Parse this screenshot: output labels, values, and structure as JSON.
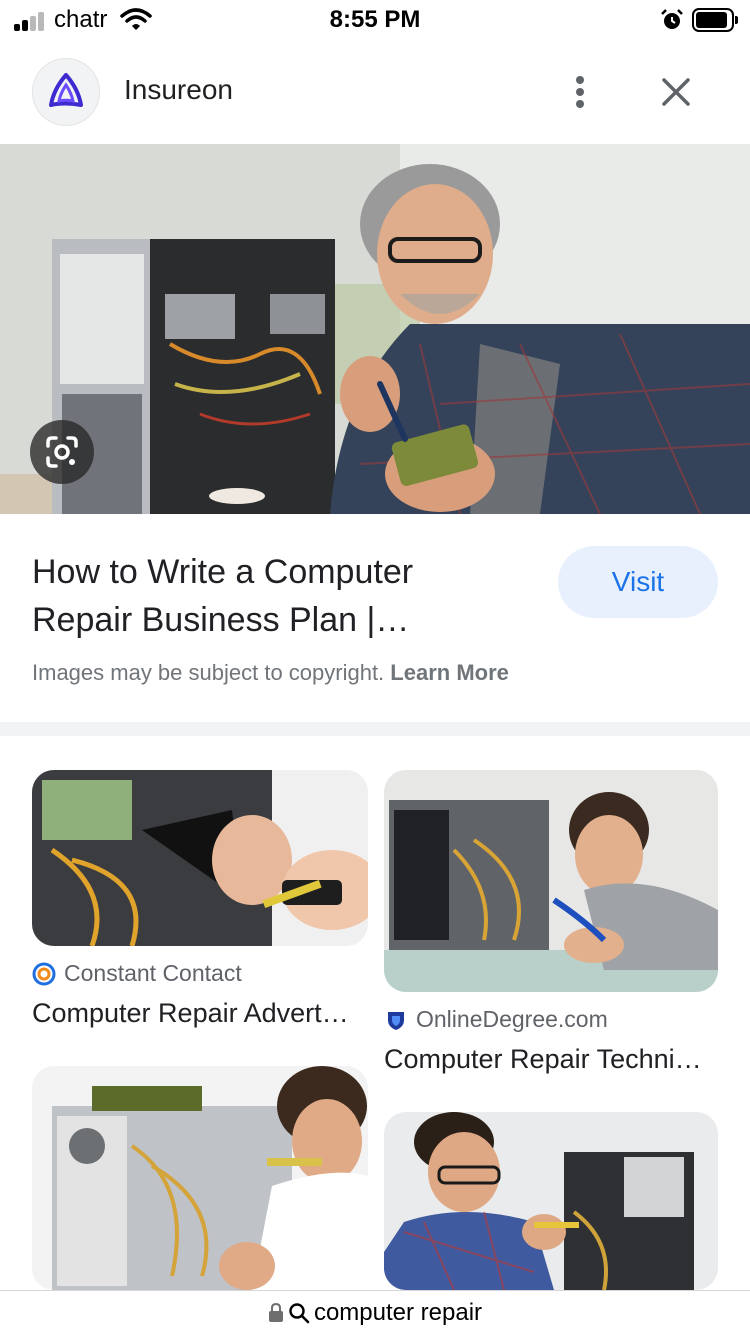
{
  "status_bar": {
    "carrier": "chatr",
    "time": "8:55 PM"
  },
  "header": {
    "site_name": "Insureon",
    "logo_icon": "insureon-logo-icon",
    "menu_icon": "more-vert-icon",
    "close_icon": "close-icon"
  },
  "result": {
    "title": "How to Write a Computer Repair Business Plan | Insureon",
    "visit_label": "Visit",
    "copyright_text": "Images may be subject to copyright.",
    "learn_more_label": "Learn More",
    "lens_icon": "lens-icon"
  },
  "related": [
    {
      "source": "Constant Contact",
      "title": "Computer Repair Advertising Ideas"
    },
    {
      "source": "OnlineDegree.com",
      "title": "Computer Repair Technician"
    },
    {
      "source": "",
      "title": ""
    },
    {
      "source": "",
      "title": ""
    }
  ],
  "url_bar": {
    "text": "computer repair",
    "lock_icon": "lock-icon",
    "search_icon": "search-icon"
  },
  "colors": {
    "accent": "#1a73e8",
    "visit_bg": "#e8f0fe",
    "secondary_text": "#70757a"
  }
}
